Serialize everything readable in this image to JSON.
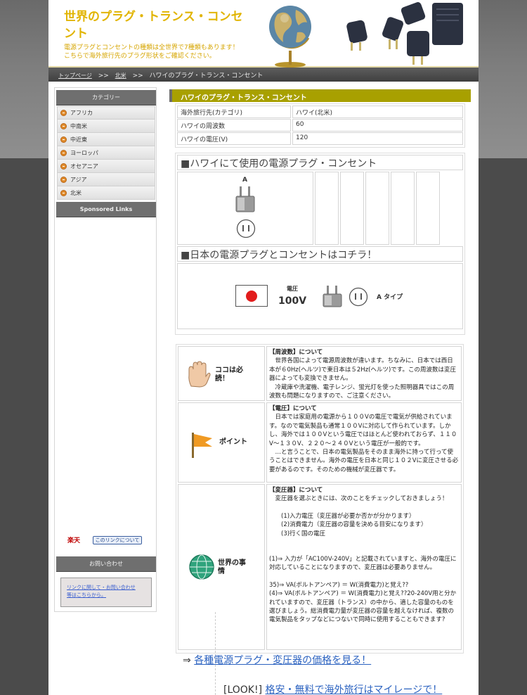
{
  "header": {
    "title": "世界のプラグ・トランス・コンセント",
    "description_line1": "電源プラグとコンセントの種類は全世界で7種類もあります！",
    "description_line2": "こちらで海外旅行先のプラグ形状をご確認ください。"
  },
  "breadcrumb": {
    "home": "トップページ",
    "sep1": ">>",
    "region": "北米",
    "sep2": ">>",
    "current": "ハワイのプラグ・トランス・コンセント"
  },
  "sidebar": {
    "category_heading": "カテゴリー",
    "categories": [
      "アフリカ",
      "中南米",
      "中近東",
      "ヨーロッパ",
      "オセアニア",
      "アジア",
      "北米"
    ],
    "sponsored_heading": "Sponsored Links",
    "rakuten_logo": "楽天",
    "rakuten_link": "このリンクについて",
    "contact_heading": "お問い合わせ",
    "contact_link_line1": "リンクに関して・お問い合わせ",
    "contact_link_line2": "等はこちらから。"
  },
  "main": {
    "title": "ハワイのプラグ・トランス・コンセント",
    "info": [
      {
        "label": "海外旅行先(カテゴリ)",
        "value": "ハワイ(北米)"
      },
      {
        "label": "ハワイの周波数",
        "value": "60"
      },
      {
        "label": "ハワイの電圧(V)",
        "value": "120"
      }
    ],
    "plug_heading": "■ハワイにて使用の電源プラグ・コンセント",
    "plug_type_label": "A",
    "japan_heading": "■日本の電源プラグとコンセントはコチラ！",
    "japan_voltage_label": "電圧",
    "japan_voltage_value": "100V",
    "japan_type_label": "A タイプ",
    "notes": [
      {
        "badge": "ココは必読！",
        "title": "【周波数】について",
        "paragraphs": [
          "　世界各国によって電源周波数が違います。ちなみに、日本では西日本が６0Hz(ヘルツ)で東日本は５2Hz(ヘルツ)です。この周波数は変圧器によっても変換できません。",
          "　冷蔵庫や洗濯機、電子レンジ、蛍光灯を使った照明器具ではこの周波数も問題になりますので、ご注意ください。"
        ]
      },
      {
        "badge": "ポイント",
        "title": "【電圧】について",
        "paragraphs": [
          "　日本では家庭用の電源から１００Vの電圧で電気が供給されています。なので電気製品も通常１００Vに対応して作られています。しかし、海外では１００Vという電圧ではほとんど使われておらず、１１０V〜１３０V、２２０〜２４０Vという電圧が一般的です。",
          "　…と言うことで、日本の電気製品をそのまま海外に持って行って使うことはできません。海外の電圧を日本と同じ１０２Vに変圧させる必要があるのです。そのための機械が変圧器です。"
        ]
      },
      {
        "badge": "世界の事情",
        "title": "【変圧器】について",
        "paragraphs": [
          "　変圧器を選ぶときには、次のことをチェックしておきましょう！",
          "",
          "　　(1)入力電圧（変圧器が必要か否かが分かります）",
          "　　(2)消費電力（変圧器の容量を決める目安になります）",
          "　　(3)行く国の電圧",
          "",
          "",
          "(1)⇒ 入力が「AC100V-240V」と記載されていますと、海外の電圧に対応していることになりますので、変圧器は必要ありません。",
          "",
          "35)⇒ VA(ボルトアンペア) ＝ W(消費電力)と覚え??",
          "(4)⇒ VA(ボルトアンペア) ＝ W(消費電力)と覚え??20-240V用と分かれていますので、変圧器（トランス）の中から、適した容量のものを選びましょう。総消費電力量が変圧器の容量を越えなければ、複数の電気製品をタップなどにつないで同時に使用することもできます?"
        ]
      }
    ],
    "link_prefix": "⇒",
    "link_text": "各種電源プラグ・変圧器の価格を見る！",
    "link2_prefix": "[LOOK!]",
    "link2_text": "格安・無料で海外旅行はマイレージで！"
  }
}
